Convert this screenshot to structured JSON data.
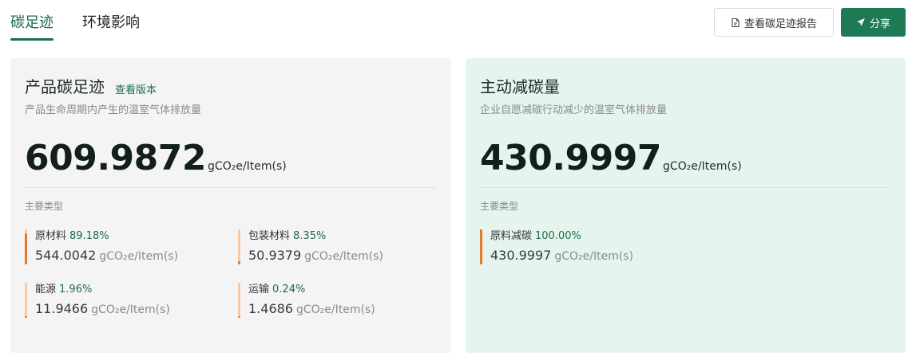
{
  "tabs": [
    {
      "label": "碳足迹",
      "active": true
    },
    {
      "label": "环境影响",
      "active": false
    }
  ],
  "toolbar": {
    "report_label": "查看碳足迹报告",
    "report_icon": "document-icon",
    "share_label": "分享",
    "share_icon": "send-icon"
  },
  "colors": {
    "brand": "#1e6b4a",
    "button": "#1e7a55",
    "bar_track": "#f9c9a3",
    "bar_fill": "#e07b2d",
    "left_card_bg": "#f4f4f4",
    "right_card_bg": "#e5f5ee"
  },
  "product": {
    "title": "产品碳足迹",
    "link": "查看版本",
    "subtitle": "产品生命周期内产生的温室气体排放量",
    "value": "609.9872",
    "unit": "gCO₂e/Item(s)",
    "section": "主要类型",
    "items": [
      {
        "name": "原材料",
        "pct": "89.18%",
        "fraction": 0.8918,
        "value": "544.0042",
        "unit": "gCO₂e/Item(s)"
      },
      {
        "name": "包装材料",
        "pct": "8.35%",
        "fraction": 0.0835,
        "value": "50.9379",
        "unit": "gCO₂e/Item(s)"
      },
      {
        "name": "能源",
        "pct": "1.96%",
        "fraction": 0.0196,
        "value": "11.9466",
        "unit": "gCO₂e/Item(s)"
      },
      {
        "name": "运输",
        "pct": "0.24%",
        "fraction": 0.0024,
        "value": "1.4686",
        "unit": "gCO₂e/Item(s)"
      }
    ]
  },
  "reduction": {
    "title": "主动减碳量",
    "subtitle": "企业自愿减碳行动减少的温室气体排放量",
    "value": "430.9997",
    "unit": "gCO₂e/Item(s)",
    "section": "主要类型",
    "items": [
      {
        "name": "原料减碳",
        "pct": "100.00%",
        "fraction": 1.0,
        "value": "430.9997",
        "unit": "gCO₂e/Item(s)"
      }
    ]
  }
}
